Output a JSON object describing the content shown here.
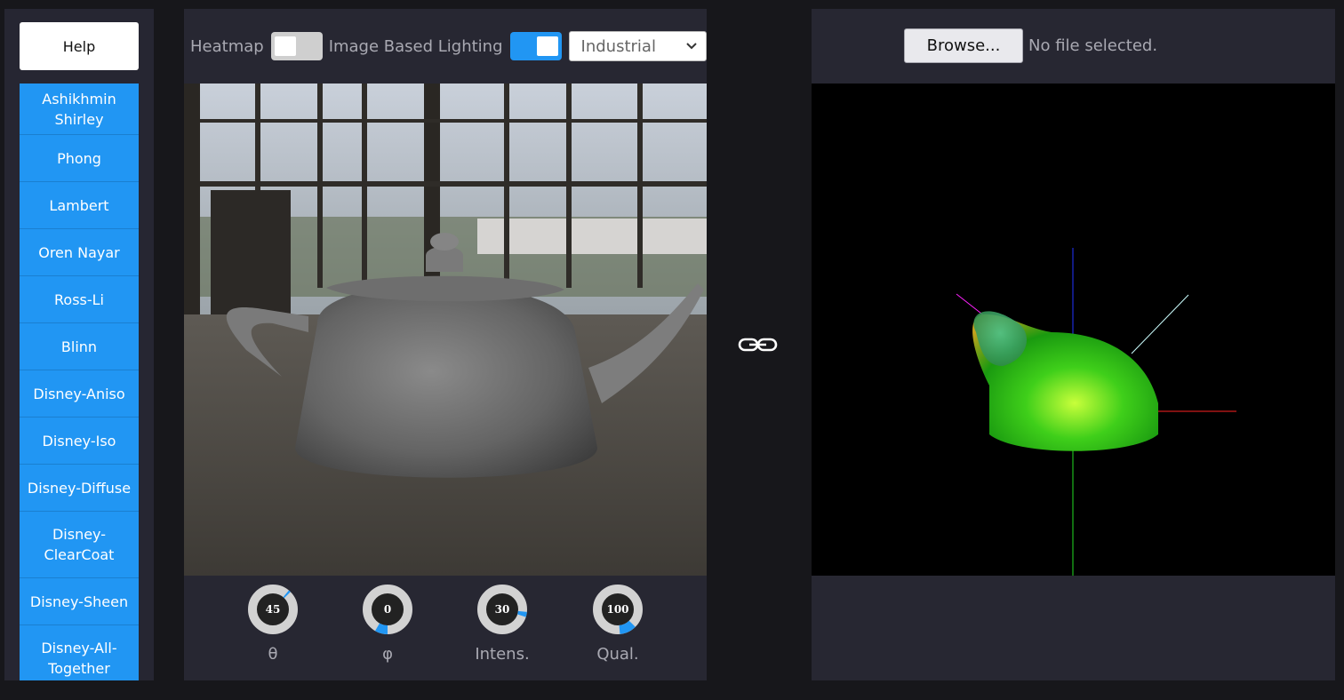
{
  "sidebar": {
    "help_label": "Help",
    "brdfs": [
      {
        "label": "Ashikhmin Shirley"
      },
      {
        "label": "Phong"
      },
      {
        "label": "Lambert"
      },
      {
        "label": "Oren Nayar"
      },
      {
        "label": "Ross-Li"
      },
      {
        "label": "Blinn"
      },
      {
        "label": "Disney-Aniso"
      },
      {
        "label": "Disney-Iso"
      },
      {
        "label": "Disney-Diffuse"
      },
      {
        "label": "Disney-ClearCoat"
      },
      {
        "label": "Disney-Sheen"
      },
      {
        "label": "Disney-All-Together"
      }
    ]
  },
  "left_panel": {
    "heatmap_label": "Heatmap",
    "heatmap_on": false,
    "ibl_label": "Image Based Lighting",
    "ibl_on": true,
    "environment": {
      "selected": "Industrial"
    },
    "dials": [
      {
        "value": "45",
        "label": "θ",
        "fraction": 0.125
      },
      {
        "value": "0",
        "label": "φ",
        "fraction": 0.0
      },
      {
        "value": "30",
        "label": "Intens.",
        "fraction": 0.3
      },
      {
        "value": "100",
        "label": "Qual.",
        "fraction": 1.0
      }
    ]
  },
  "link_icon": "link-icon",
  "right_panel": {
    "browse_label": "Browse...",
    "file_status": "No file selected."
  },
  "colors": {
    "accent": "#2196f3",
    "panel": "#272732",
    "background": "#17171b"
  }
}
